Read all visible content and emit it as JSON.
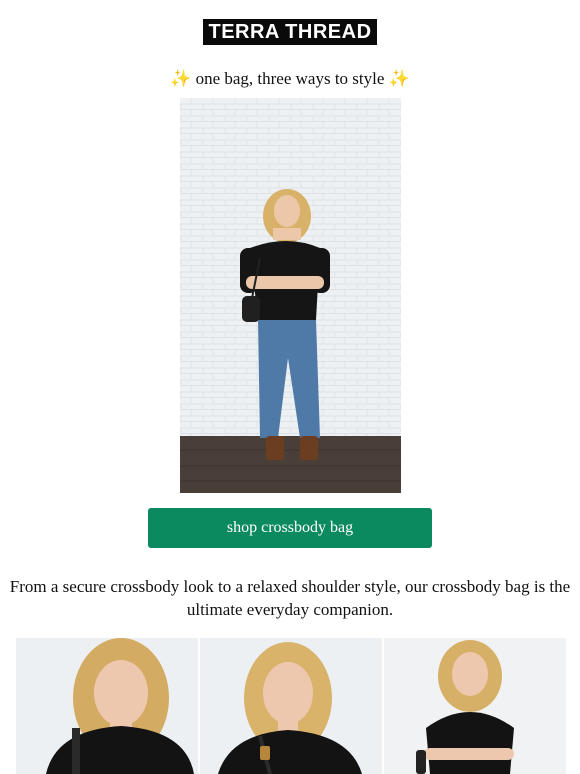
{
  "header": {
    "brand": "TERRA THREAD"
  },
  "intro": {
    "spark_left": "✨",
    "tagline": "one bag, three ways to style",
    "spark_right": "✨"
  },
  "hero": {
    "alt": "model wearing crossbody bag against white brick wall"
  },
  "cta": {
    "label": "shop crossbody bag"
  },
  "body": {
    "text": "From a secure crossbody look to a relaxed shoulder style, our crossbody bag is the ultimate everyday companion."
  },
  "colors": {
    "cta_bg": "#0b8a5f",
    "logo_bg": "#0a0a0a",
    "spark": "#f3b400"
  }
}
